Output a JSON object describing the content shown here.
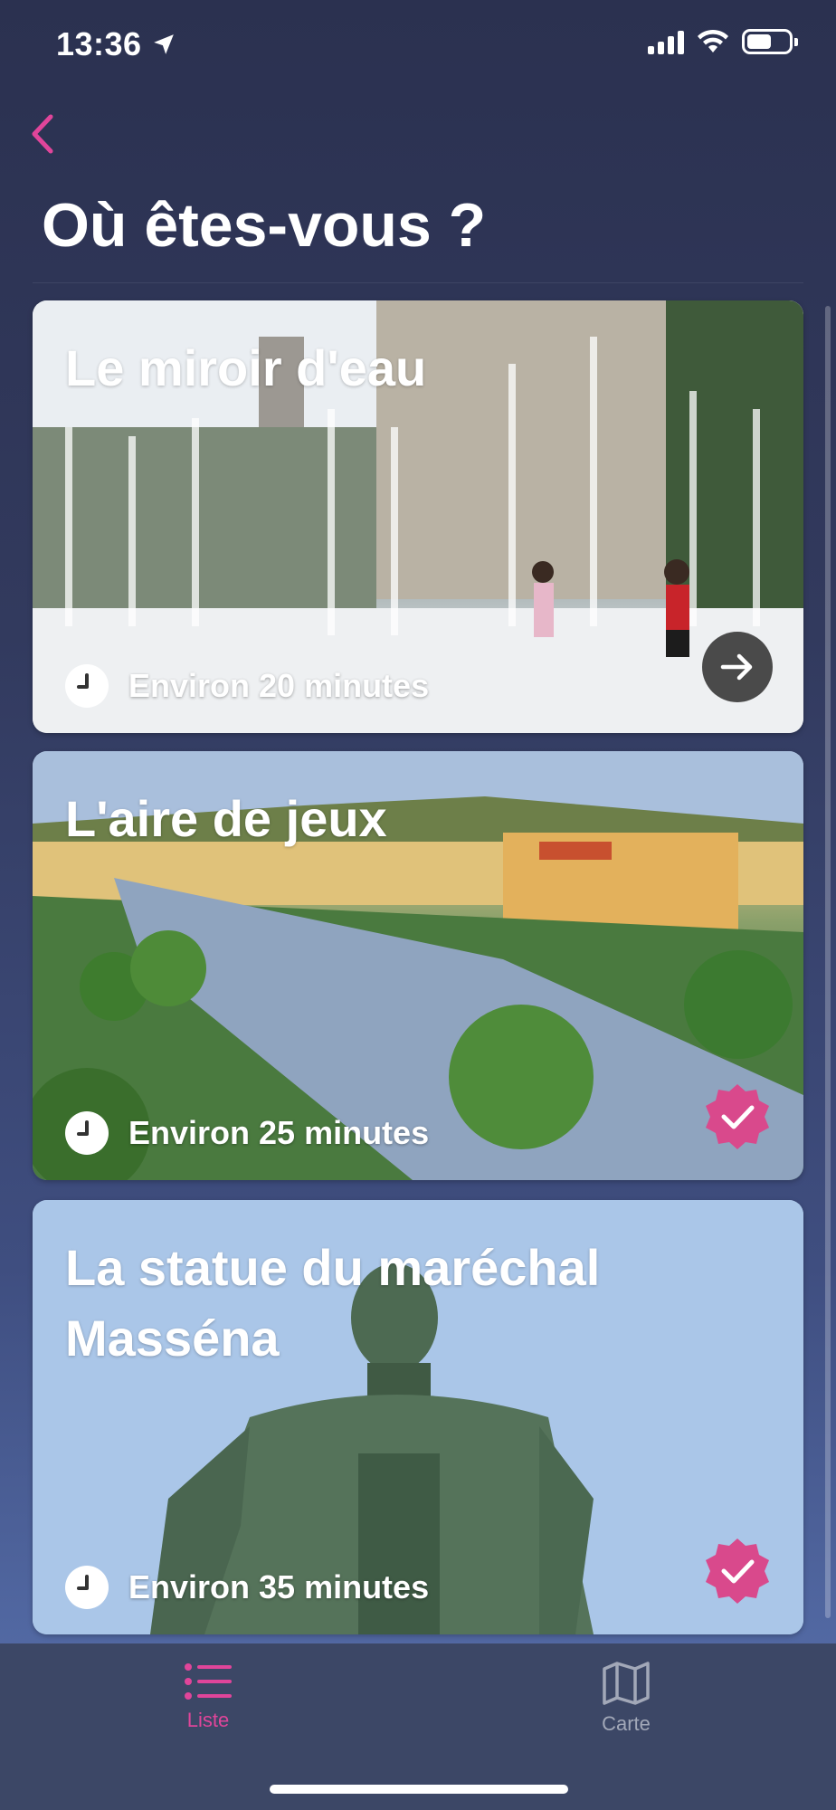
{
  "status_bar": {
    "time": "13:36"
  },
  "header": {
    "title": "Où êtes-vous ?"
  },
  "cards": [
    {
      "title": "Le miroir d'eau",
      "duration": "Environ 20 minutes",
      "state": "next"
    },
    {
      "title": "L'aire de jeux",
      "duration": "Environ 25 minutes",
      "state": "completed"
    },
    {
      "title": "La statue du maréchal Masséna",
      "duration": "Environ 35 minutes",
      "state": "completed"
    }
  ],
  "tab_bar": {
    "tabs": [
      {
        "label": "Liste",
        "icon": "list-icon",
        "active": true
      },
      {
        "label": "Carte",
        "icon": "map-icon",
        "active": false
      }
    ]
  },
  "colors": {
    "accent": "#e0459a",
    "background": "#2b3150",
    "tab_bar": "#3c4766",
    "inactive": "#a2a8b8"
  }
}
